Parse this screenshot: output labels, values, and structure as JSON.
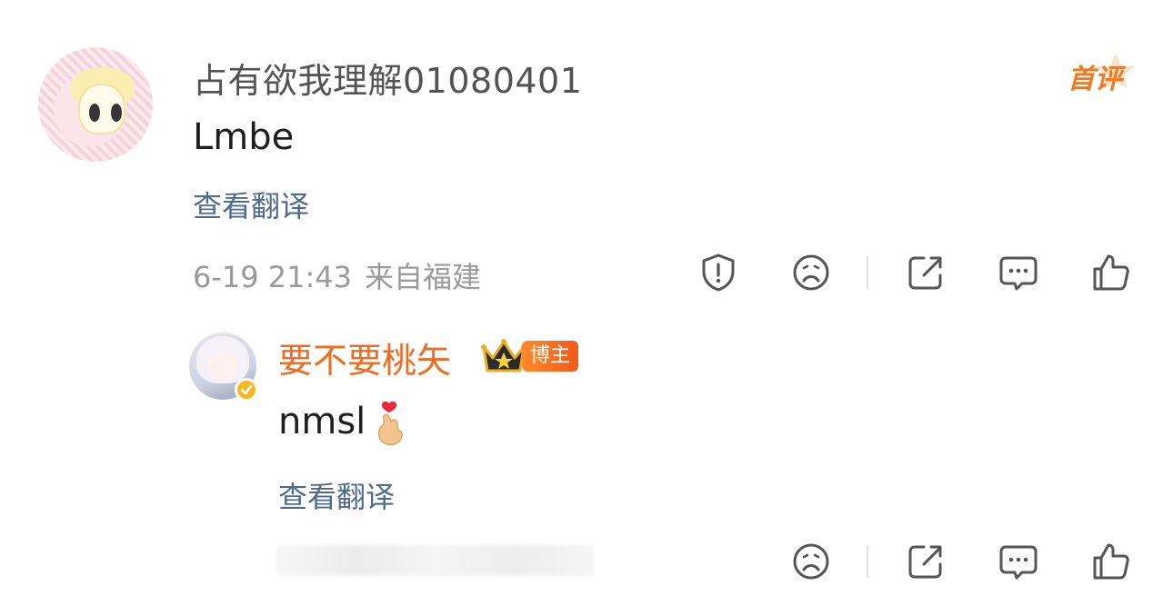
{
  "comment": {
    "username": "占有欲我理解01080401",
    "text": "Lmbe",
    "translate_label": "查看翻译",
    "date": "6-19 21:43",
    "location": "来自福建",
    "badge_first": "首评"
  },
  "reply": {
    "username": "要不要桃矢",
    "host_badge": "博主",
    "text": "nmsl",
    "emoji_icon": "finger-heart-emoji",
    "translate_label": "查看翻译"
  },
  "actions": [
    "report",
    "dislike",
    "share",
    "reply",
    "like"
  ],
  "colors": {
    "link": "#4f6a8c",
    "host_name": "#ef6c22",
    "badge_orange": "#f07a21",
    "verified": "#f5b91f"
  }
}
